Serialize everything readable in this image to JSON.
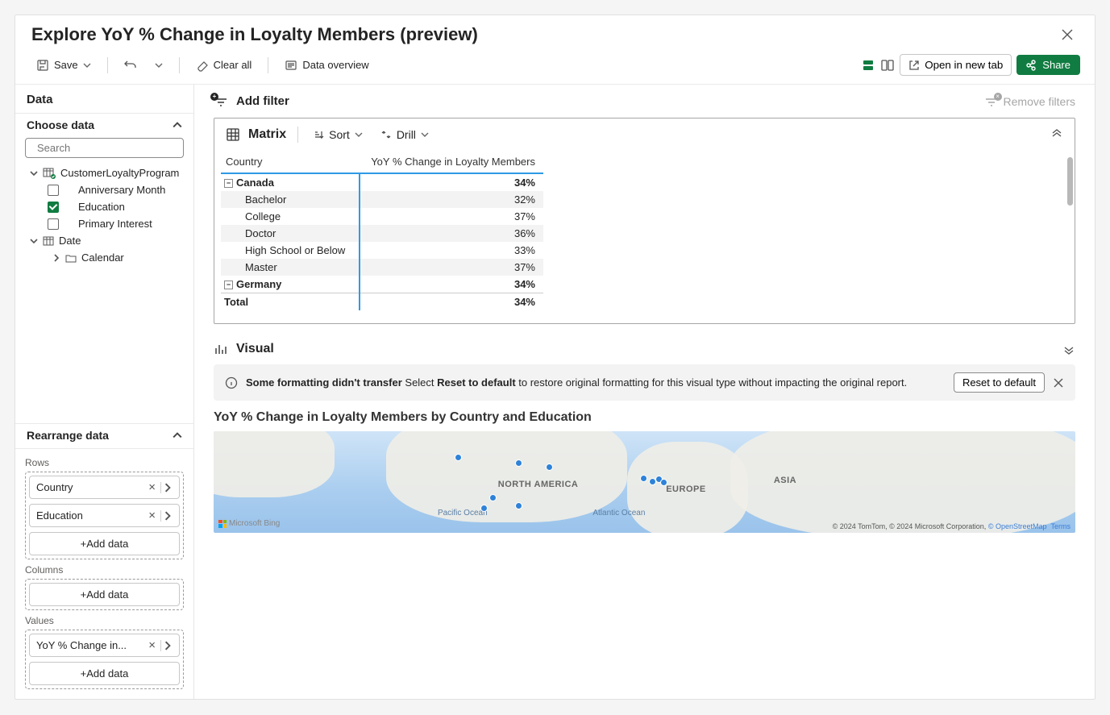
{
  "title": "Explore YoY % Change in Loyalty Members (preview)",
  "toolbar": {
    "save": "Save",
    "clear_all": "Clear all",
    "data_overview": "Data overview",
    "open_new_tab": "Open in new tab",
    "share": "Share"
  },
  "sidebar": {
    "data_header": "Data",
    "choose_data": "Choose data",
    "search_placeholder": "Search",
    "table_customer": "CustomerLoyaltyProgram",
    "fields": {
      "anniversary": "Anniversary Month",
      "education": "Education",
      "primary_interest": "Primary Interest"
    },
    "table_date": "Date",
    "date_calendar": "Calendar",
    "rearrange_header": "Rearrange data",
    "rows_label": "Rows",
    "columns_label": "Columns",
    "values_label": "Values",
    "add_data": "+Add data",
    "row_pills": {
      "country": "Country",
      "education": "Education"
    },
    "value_pill": "YoY % Change in..."
  },
  "filter": {
    "add": "Add filter",
    "remove": "Remove filters"
  },
  "matrix": {
    "title": "Matrix",
    "sort": "Sort",
    "drill": "Drill",
    "col_country": "Country",
    "col_value": "YoY % Change in Loyalty Members",
    "rows": [
      {
        "type": "group",
        "label": "Canada",
        "value": "34%"
      },
      {
        "type": "child",
        "label": "Bachelor",
        "value": "32%",
        "alt": true
      },
      {
        "type": "child",
        "label": "College",
        "value": "37%"
      },
      {
        "type": "child",
        "label": "Doctor",
        "value": "36%",
        "alt": true
      },
      {
        "type": "child",
        "label": "High School or Below",
        "value": "33%"
      },
      {
        "type": "child",
        "label": "Master",
        "value": "37%",
        "alt": true
      },
      {
        "type": "group",
        "label": "Germany",
        "value": "34%"
      },
      {
        "type": "total",
        "label": "Total",
        "value": "34%"
      }
    ]
  },
  "visual": {
    "title": "Visual",
    "info_bold1": "Some formatting didn't transfer",
    "info_plain1": " Select ",
    "info_bold2": "Reset to default",
    "info_plain2": " to restore original formatting for this visual type without impacting the original report.",
    "reset_btn": "Reset to default",
    "map_title": "YoY % Change in Loyalty Members by Country and Education",
    "labels": {
      "na": "NORTH AMERICA",
      "eu": "EUROPE",
      "asia": "ASIA",
      "pac": "Pacific Ocean",
      "atl": "Atlantic Ocean"
    },
    "legal": "© 2024 TomTom, © 2024 Microsoft Corporation, ",
    "osm": "© OpenStreetMap",
    "terms": "Terms",
    "bing": "Microsoft Bing"
  }
}
